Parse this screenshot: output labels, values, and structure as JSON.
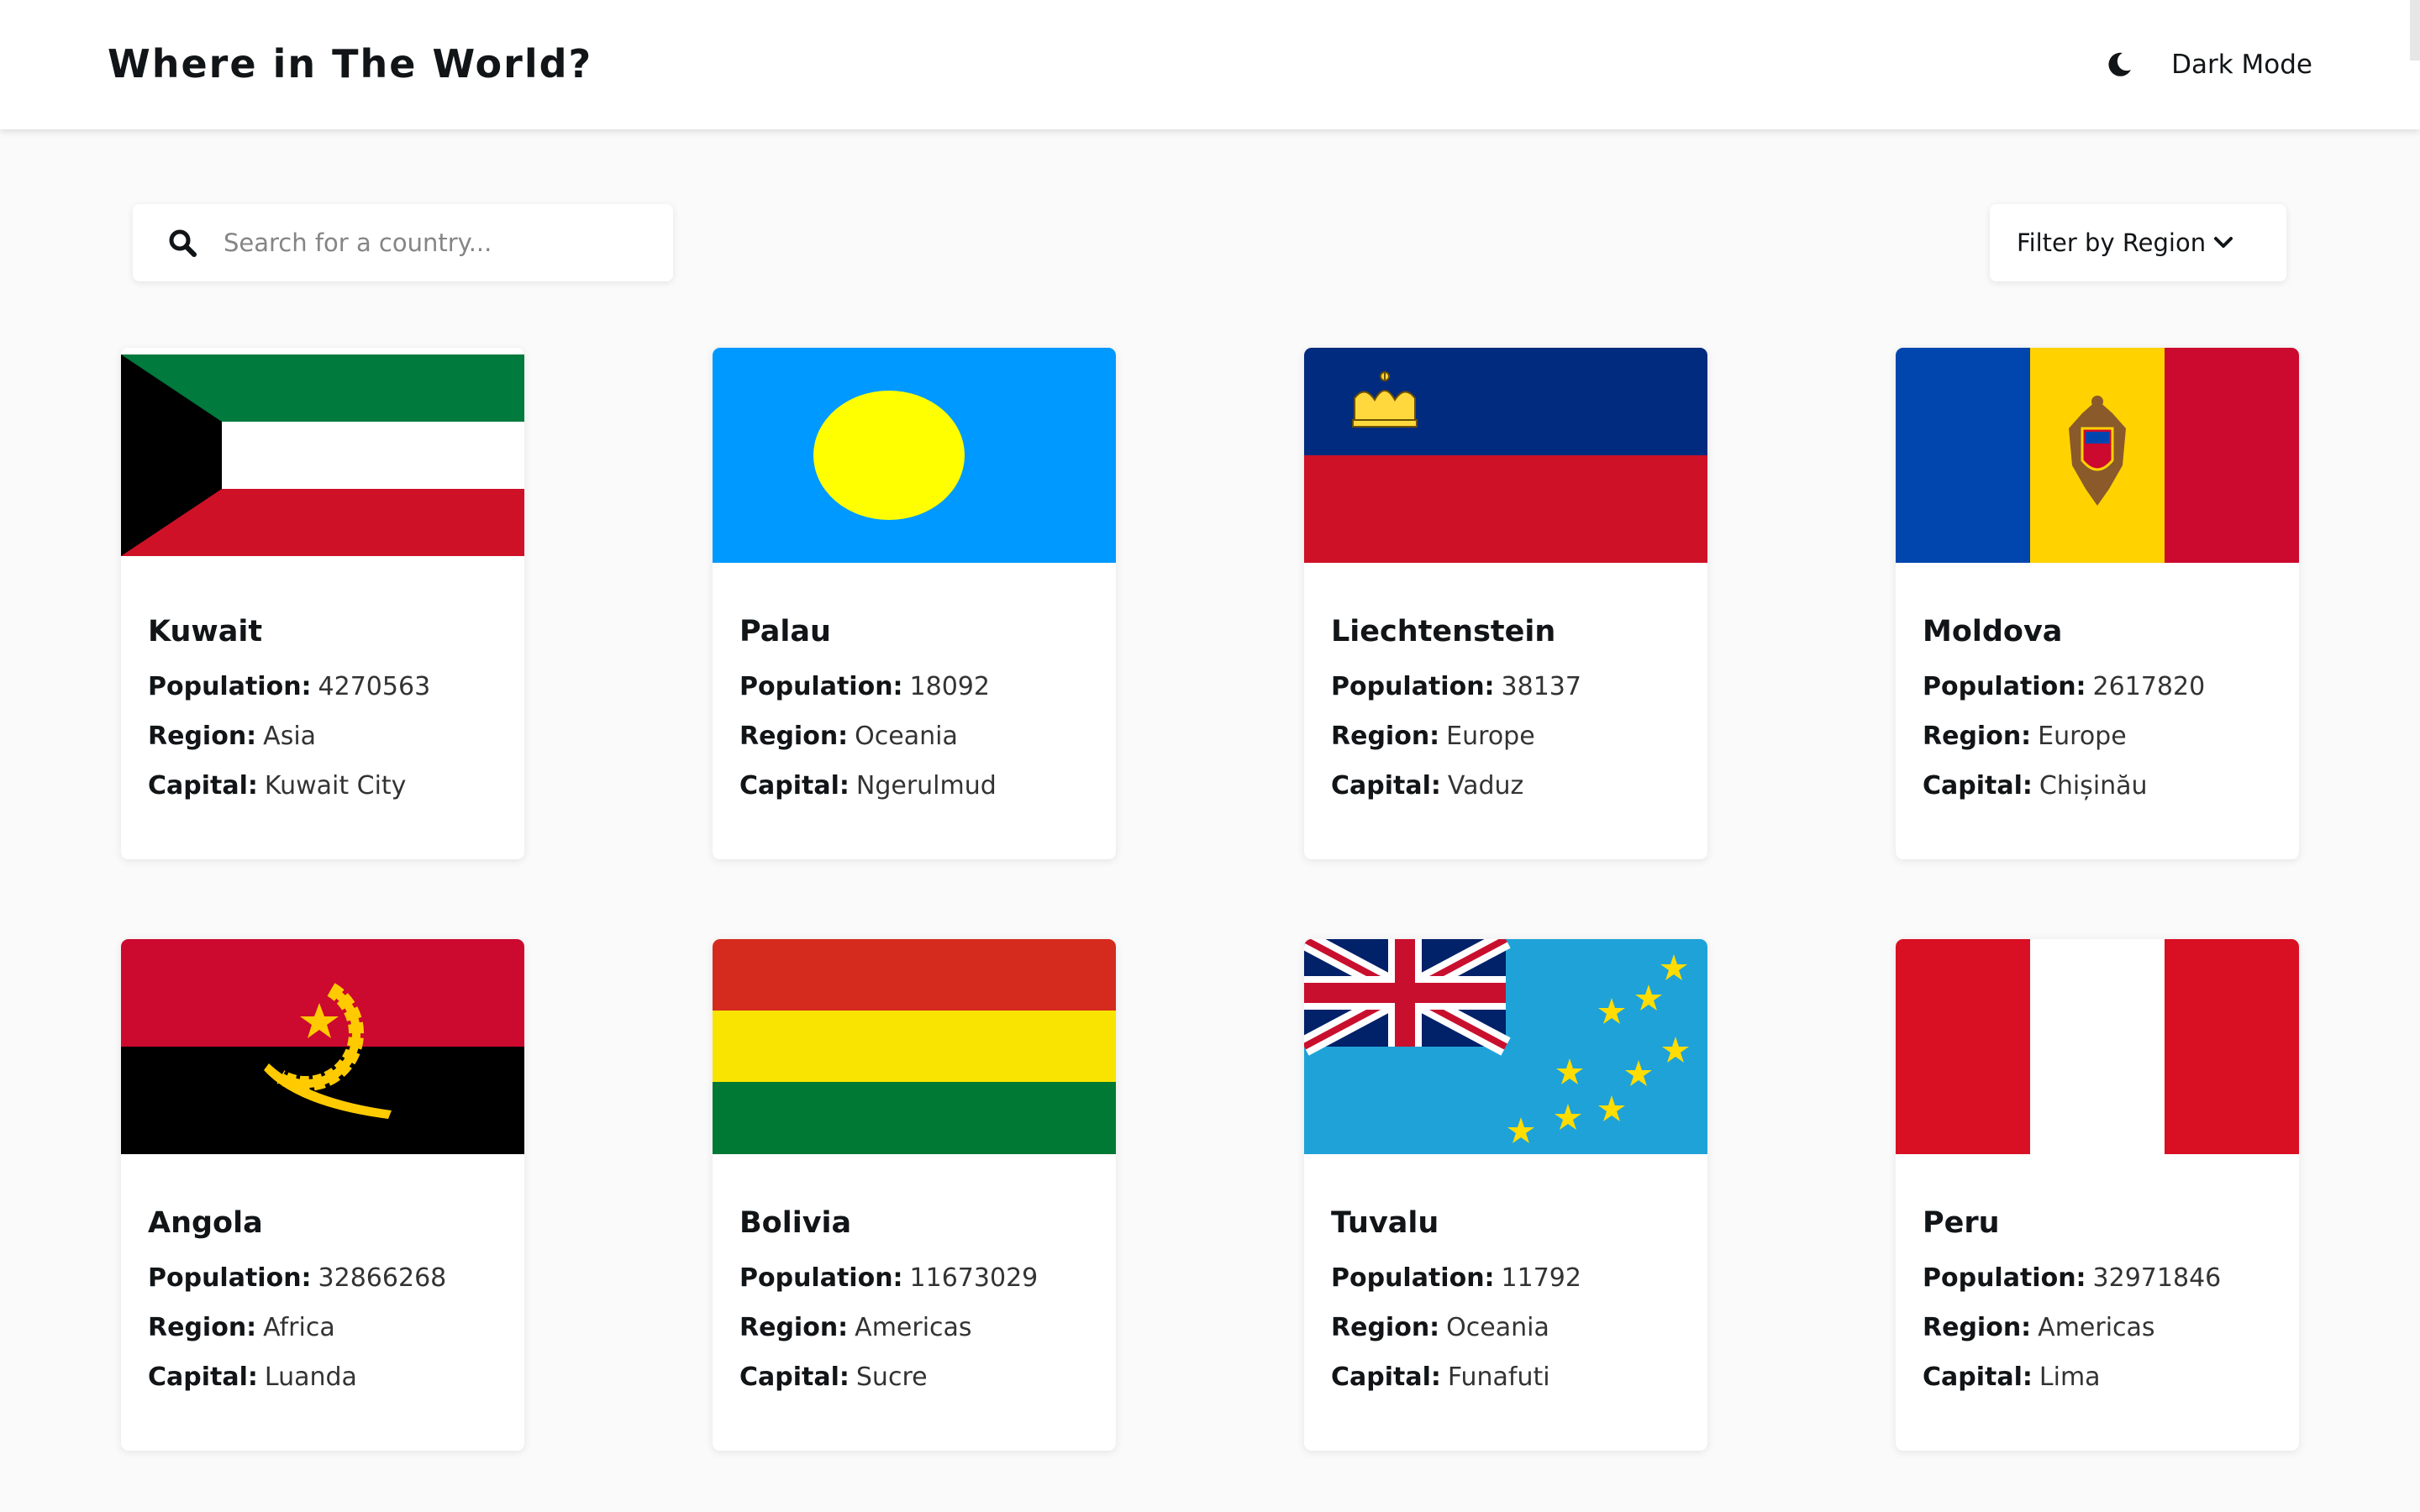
{
  "header": {
    "title": "Where in The World?",
    "theme_toggle_label": "Dark Mode",
    "theme_icon": "moon-icon"
  },
  "search": {
    "placeholder": "Search for a country...",
    "value": "",
    "icon": "search-icon"
  },
  "filter": {
    "label": "Filter by Region",
    "icon": "chevron-down-icon"
  },
  "labels": {
    "population": "Population:",
    "region": "Region:",
    "capital": "Capital:"
  },
  "countries": [
    {
      "name": "Kuwait",
      "population": "4270563",
      "region": "Asia",
      "capital": "Kuwait City"
    },
    {
      "name": "Palau",
      "population": "18092",
      "region": "Oceania",
      "capital": "Ngerulmud"
    },
    {
      "name": "Liechtenstein",
      "population": "38137",
      "region": "Europe",
      "capital": "Vaduz"
    },
    {
      "name": "Moldova",
      "population": "2617820",
      "region": "Europe",
      "capital": "Chișinău"
    },
    {
      "name": "Angola",
      "population": "32866268",
      "region": "Africa",
      "capital": "Luanda"
    },
    {
      "name": "Bolivia",
      "population": "11673029",
      "region": "Americas",
      "capital": "Sucre"
    },
    {
      "name": "Tuvalu",
      "population": "11792",
      "region": "Oceania",
      "capital": "Funafuti"
    },
    {
      "name": "Peru",
      "population": "32971846",
      "region": "Americas",
      "capital": "Lima"
    }
  ],
  "colors": {
    "background": "#fafafa",
    "surface": "#ffffff",
    "text": "#111517",
    "placeholder": "#858585"
  }
}
